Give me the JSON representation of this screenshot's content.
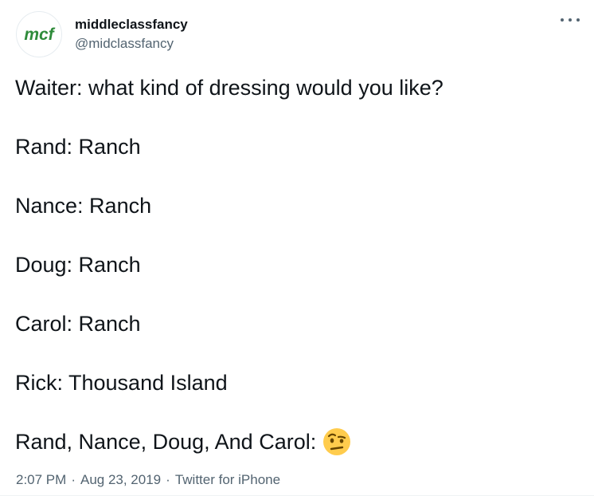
{
  "author": {
    "avatar_text": "mcf",
    "display_name": "middleclassfancy",
    "handle": "@midclassfancy"
  },
  "tweet": {
    "lines": [
      "Waiter: what kind of dressing would you like?",
      "Rand: Ranch",
      "Nance: Ranch",
      "Doug: Ranch",
      "Carol: Ranch",
      "Rick: Thousand Island",
      "Rand, Nance, Doug, And Carol:"
    ],
    "emoji": "face-with-raised-eyebrow"
  },
  "meta": {
    "time": "2:07 PM",
    "date": "Aug 23, 2019",
    "source": "Twitter for iPhone",
    "separator": "·"
  },
  "colors": {
    "avatar_green": "#2e8b3a",
    "text": "#0f1419",
    "muted": "#536471"
  }
}
